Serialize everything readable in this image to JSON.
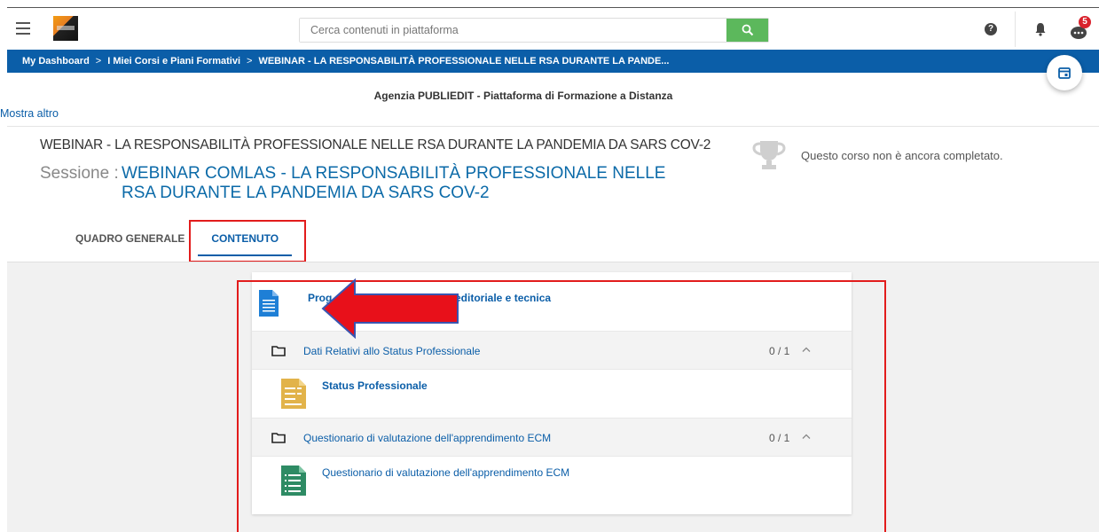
{
  "header": {
    "search_placeholder": "Cerca contenuti in piattaforma",
    "notification_count": "5"
  },
  "breadcrumb": {
    "items": [
      "My Dashboard",
      "I Miei Corsi e Piani Formativi",
      "WEBINAR - LA RESPONSABILITÀ PROFESSIONALE NELLE RSA DURANTE LA PANDE..."
    ],
    "separator": ">"
  },
  "agency": "Agenzia PUBLIEDIT -  Piattaforma di Formazione a Distanza",
  "show_more": "Mostra altro",
  "course": {
    "title": "WEBINAR - LA RESPONSABILITÀ PROFESSIONALE NELLE RSA DURANTE LA PANDEMIA DA SARS COV-2",
    "session_label": "Sessione :",
    "session_name": "WEBINAR COMLAS - LA RESPONSABILITÀ PROFESSIONALE NELLE RSA DURANTE LA PANDEMIA DA SARS COV-2",
    "status": "Questo corso non è ancora completato."
  },
  "tabs": [
    {
      "label": "QUADRO GENERALE",
      "active": false
    },
    {
      "label": "CONTENUTO",
      "active": true
    }
  ],
  "content": {
    "first_item": {
      "label_start": "Prog",
      "label_end": "editoriale e tecnica",
      "icon": "document-icon"
    },
    "folders": [
      {
        "label": "Dati Relativi allo Status Professionale",
        "count": "0 / 1",
        "item": {
          "label": "Status Professionale",
          "icon": "form-icon"
        }
      },
      {
        "label": "Questionario di valutazione dell'apprendimento ECM",
        "count": "0 / 1",
        "item": {
          "label": "Questionario di valutazione dell'apprendimento ECM",
          "icon": "questionnaire-icon"
        }
      }
    ]
  },
  "colors": {
    "brand_blue": "#0b5ea8",
    "search_green": "#5cb85c",
    "annotation_red": "#e21c1c"
  }
}
